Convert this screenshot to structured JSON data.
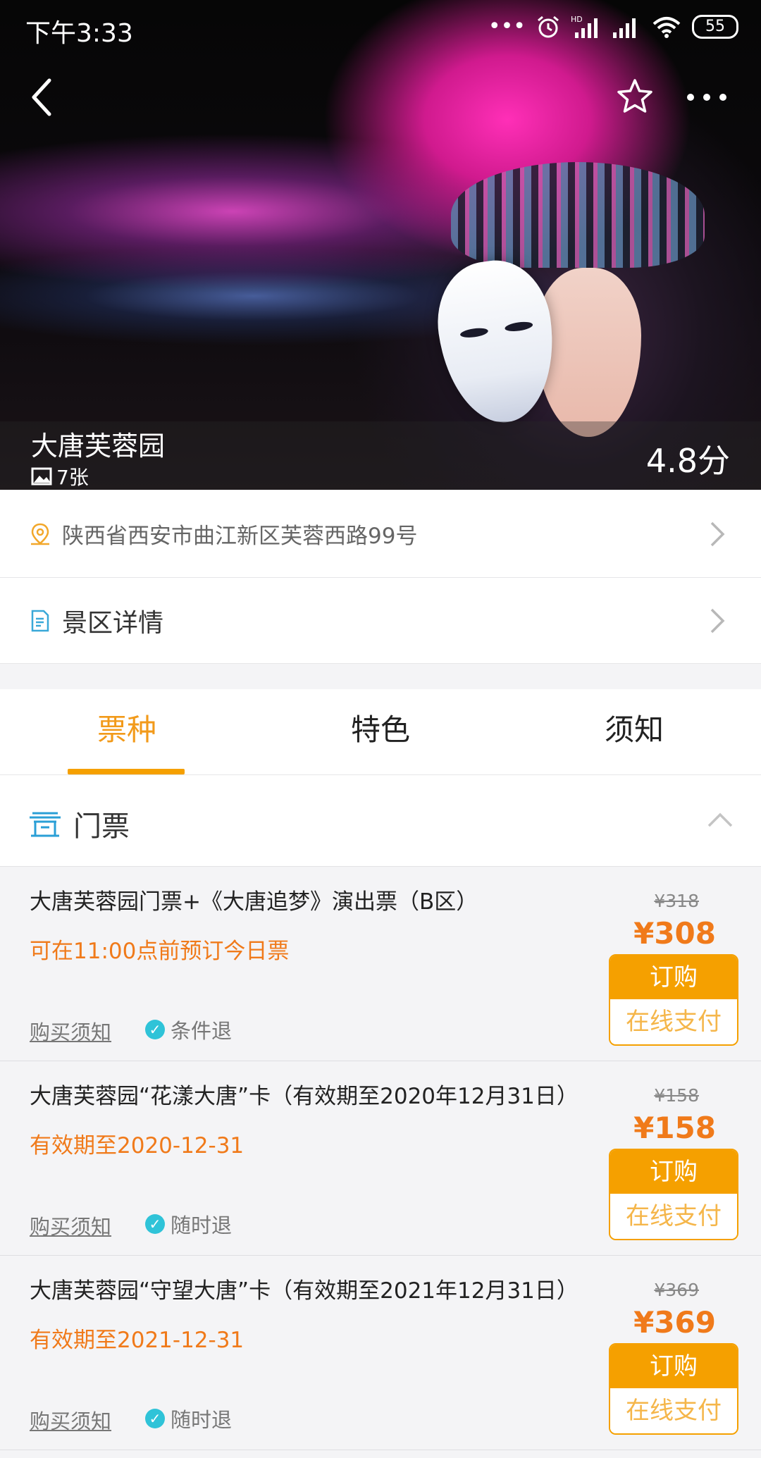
{
  "status_bar": {
    "time": "下午3:33",
    "battery": "55",
    "hd": "HD"
  },
  "hero": {
    "title": "大唐芙蓉园",
    "photo_count": "7张",
    "score": "4.8分"
  },
  "address": {
    "text": "陕西省西安市曲江新区芙蓉西路99号"
  },
  "detail": {
    "text": "景区详情"
  },
  "tabs": [
    {
      "label": "票种",
      "active": true
    },
    {
      "label": "特色",
      "active": false
    },
    {
      "label": "须知",
      "active": false
    }
  ],
  "section": {
    "title": "门票"
  },
  "tickets": [
    {
      "name": "大唐芙蓉园门票+《大唐追梦》演出票（B区）",
      "sub": "可在11:00点前预订今日票",
      "original_price": "¥318",
      "price": "¥308",
      "buy_label": "订购",
      "pay_label": "在线支付",
      "notice_label": "购买须知",
      "refund_label": "条件退"
    },
    {
      "name": "大唐芙蓉园“花漾大唐”卡（有效期至2020年12月31日）",
      "sub": "有效期至2020-12-31",
      "original_price": "¥158",
      "price": "¥158",
      "buy_label": "订购",
      "pay_label": "在线支付",
      "notice_label": "购买须知",
      "refund_label": "随时退"
    },
    {
      "name": "大唐芙蓉园“守望大唐”卡（有效期至2021年12月31日）",
      "sub": "有效期至2021-12-31",
      "original_price": "¥369",
      "price": "¥369",
      "buy_label": "订购",
      "pay_label": "在线支付",
      "notice_label": "购买须知",
      "refund_label": "随时退"
    }
  ],
  "colors": {
    "accent": "#f5a000",
    "price": "#f07a1a",
    "refund_check": "#2fc3d8",
    "background": "#f4f4f6"
  }
}
